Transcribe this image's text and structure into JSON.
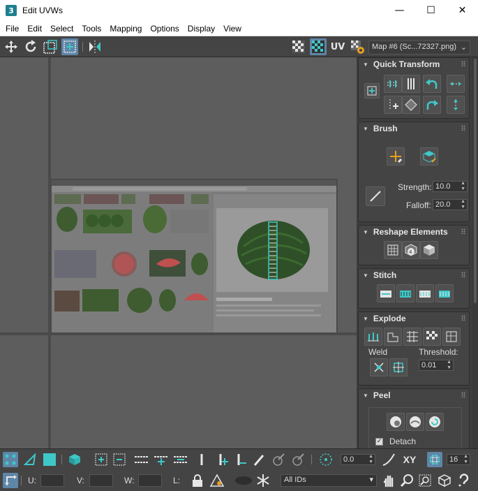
{
  "window": {
    "title": "Edit UVWs",
    "app_icon": "3"
  },
  "window_controls": {
    "minimize": "—",
    "maximize": "☐",
    "close": "✕"
  },
  "menu": [
    "File",
    "Edit",
    "Select",
    "Tools",
    "Mapping",
    "Options",
    "Display",
    "View"
  ],
  "toolbar": {
    "uv_label": "UV",
    "map_select": "Map #6 (Sc...72327.png)"
  },
  "panel": {
    "quick_transform": {
      "title": "Quick Transform"
    },
    "brush": {
      "title": "Brush",
      "strength_label": "Strength:",
      "strength_value": "10.0",
      "falloff_label": "Falloff:",
      "falloff_value": "20.0"
    },
    "reshape": {
      "title": "Reshape Elements"
    },
    "stitch": {
      "title": "Stitch"
    },
    "explode": {
      "title": "Explode",
      "weld_label": "Weld",
      "threshold_label": "Threshold:",
      "threshold_value": "0.01"
    },
    "peel": {
      "title": "Peel",
      "detach_label": "Detach",
      "detach_checked": true
    }
  },
  "bottom": {
    "rotation_value": "0.0",
    "xy_label": "XY",
    "grid_value": "16",
    "u_label": "U:",
    "v_label": "V:",
    "w_label": "W:",
    "l_label": "L:",
    "ids_select": "All IDs"
  },
  "colors": {
    "accent": "#3fc8c8",
    "active_button": "#5e86a8",
    "panel_bg": "#444444",
    "viewport_bg": "#5d5d5d"
  }
}
